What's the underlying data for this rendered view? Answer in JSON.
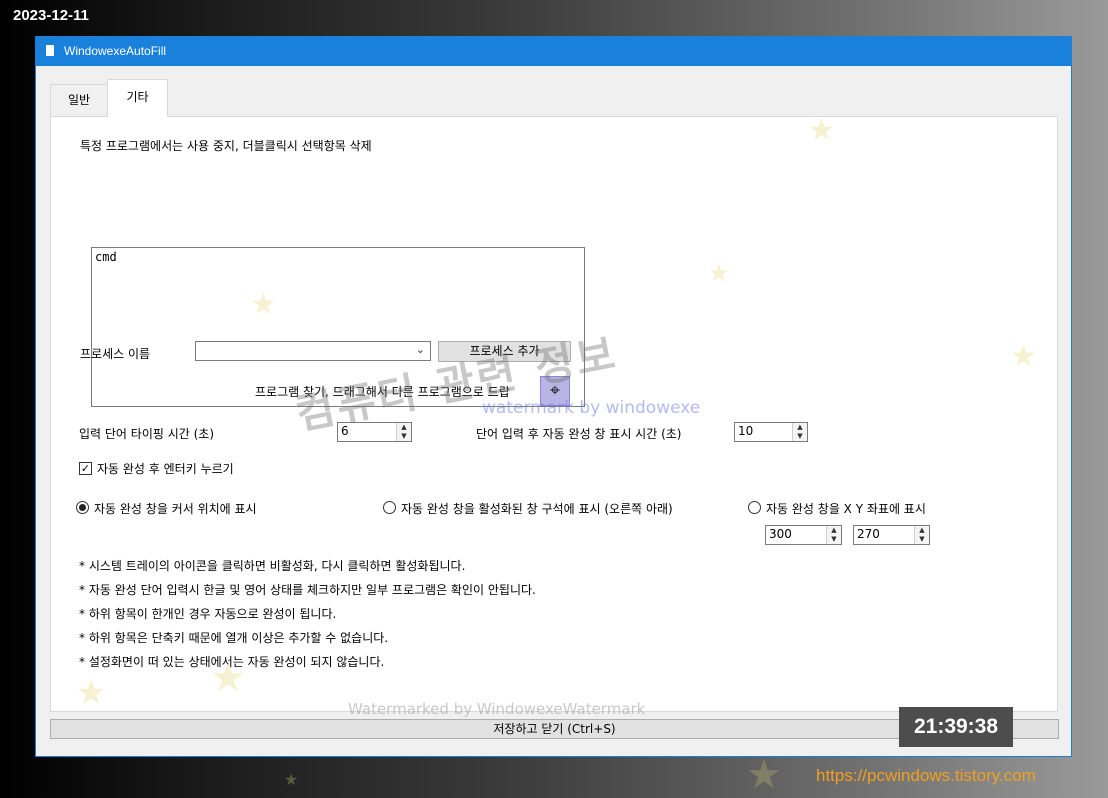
{
  "overlay": {
    "date": "2023-12-11",
    "clock": "21:39:38",
    "url": "https://pcwindows.tistory.com",
    "watermark_big": "컴퓨터 관련 정보",
    "watermark_small": "watermark by windowexe",
    "watermark_bottom": "Watermarked by WindowexeWatermark"
  },
  "window": {
    "title": "WindowexeAutoFill",
    "close_glyph": "✕",
    "tabs": [
      {
        "label": "일반",
        "active": false
      },
      {
        "label": "기타",
        "active": true
      }
    ]
  },
  "panel": {
    "exclude_label": "특정 프로그램에서는 사용 중지, 더블클릭시 선택항목 삭제",
    "exclude_list": [
      "cmd"
    ],
    "process_name_label": "프로세스 이름",
    "process_name_value": "",
    "add_process_button": "프로세스 추가",
    "drag_label": "프로그램 찾기, 드래그해서 다른 프로그램으로 드랍",
    "typing_time_label": "입력 단어 타이핑 시간 (초)",
    "typing_time_value": "6",
    "popup_time_label": "단어 입력 후 자동 완성 창 표시 시간 (초)",
    "popup_time_value": "10",
    "enter_checkbox_label": "자동 완성 후 엔터키 누르기",
    "enter_checked": true,
    "radio_cursor_label": "자동 완성 창을 커서 위치에 표시",
    "radio_corner_label": "자동 완성 창을 활성화된 창 구석에 표시 (오른쪽 아래)",
    "radio_xy_label": "자동 완성 창을 X Y 좌표에 표시",
    "selected_radio": "cursor",
    "x_value": "300",
    "y_value": "270",
    "notes": [
      "* 시스템 트레이의 아이콘을 클릭하면 비활성화, 다시 클릭하면 활성화됩니다.",
      "* 자동 완성 단어 입력시 한글 및 영어 상태를 체크하지만 일부 프로그램은 확인이 안됩니다.",
      "* 하위 항목이 한개인 경우 자동으로 완성이 됩니다.",
      "* 하위 항목은 단축키 때문에 열개 이상은 추가할 수 없습니다.",
      "* 설정화면이 떠 있는 상태에서는 자동 완성이 되지 않습니다."
    ],
    "save_button": "저장하고 닫기 (Ctrl+S)"
  },
  "icons": {
    "check": "✓",
    "target": "⌖",
    "combo_arrow": "⌄",
    "spin_up": "▲",
    "spin_down": "▼"
  }
}
